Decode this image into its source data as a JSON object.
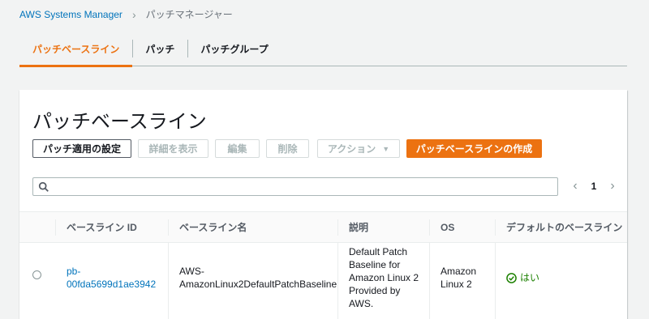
{
  "breadcrumb": {
    "root": "AWS Systems Manager",
    "current": "パッチマネージャー"
  },
  "tabs": [
    {
      "label": "パッチベースライン",
      "active": true
    },
    {
      "label": "パッチ",
      "active": false
    },
    {
      "label": "パッチグループ",
      "active": false
    }
  ],
  "panel": {
    "title": "パッチベースライン"
  },
  "toolbar": {
    "configure_patching": "パッチ適用の設定",
    "view_details": "詳細を表示",
    "edit": "編集",
    "delete": "削除",
    "actions": "アクション",
    "create": "パッチベースラインの作成"
  },
  "search": {
    "placeholder": "",
    "value": ""
  },
  "pagination": {
    "current_page": "1"
  },
  "table": {
    "columns": [
      "ベースライン ID",
      "ベースライン名",
      "説明",
      "OS",
      "デフォルトのベースライン"
    ],
    "rows": [
      {
        "id_line1": "pb-",
        "id_line2": "00fda5699d1ae3942",
        "name_line1": "AWS-",
        "name_line2": "AmazonLinux2DefaultPatchBaseline",
        "desc_lines": [
          "Default Patch",
          "Baseline for",
          "Amazon Linux 2",
          "Provided by",
          "AWS."
        ],
        "os_line1": "Amazon",
        "os_line2": "Linux 2",
        "default": "はい"
      }
    ]
  },
  "colors": {
    "accent": "#ec7211",
    "link": "#0073bb",
    "success": "#1d8102"
  }
}
